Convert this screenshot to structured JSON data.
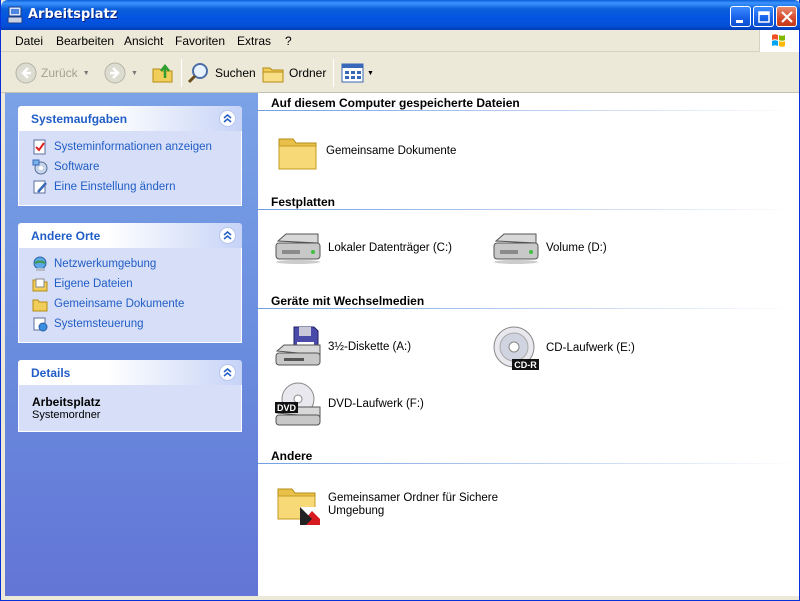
{
  "window": {
    "title": "Arbeitsplatz"
  },
  "menu": [
    "Datei",
    "Bearbeiten",
    "Ansicht",
    "Favoriten",
    "Extras",
    "?"
  ],
  "toolbar": {
    "back_label": "Zurück",
    "search_label": "Suchen",
    "folders_label": "Ordner"
  },
  "sidebar": {
    "system_tasks": {
      "title": "Systemaufgaben",
      "items": [
        "Systeminformationen anzeigen",
        "Software",
        "Eine Einstellung ändern"
      ]
    },
    "other_places": {
      "title": "Andere Orte",
      "items": [
        "Netzwerkumgebung",
        "Eigene Dateien",
        "Gemeinsame Dokumente",
        "Systemsteuerung"
      ]
    },
    "details": {
      "title": "Details",
      "name": "Arbeitsplatz",
      "type": "Systemordner"
    }
  },
  "content": {
    "groups": [
      {
        "title": "Auf diesem Computer gespeicherte Dateien",
        "items": [
          "Gemeinsame Dokumente"
        ]
      },
      {
        "title": "Festplatten",
        "items": [
          "Lokaler Datenträger (C:)",
          "Volume (D:)"
        ]
      },
      {
        "title": "Geräte mit Wechselmedien",
        "items": [
          "3½-Diskette (A:)",
          "CD-Laufwerk (E:)",
          "DVD-Laufwerk (F:)"
        ]
      },
      {
        "title": "Andere",
        "items": [
          "Gemeinsamer Ordner für Sichere Umgebung"
        ]
      }
    ],
    "badges": {
      "cd": "CD-R",
      "dvd": "DVD"
    }
  },
  "colors": {
    "titlebar": "#0A5FD9",
    "sidebar_link": "#215DC6",
    "sidebar_bg": "#6A8DDE",
    "panel_body": "#D6DFF7"
  }
}
